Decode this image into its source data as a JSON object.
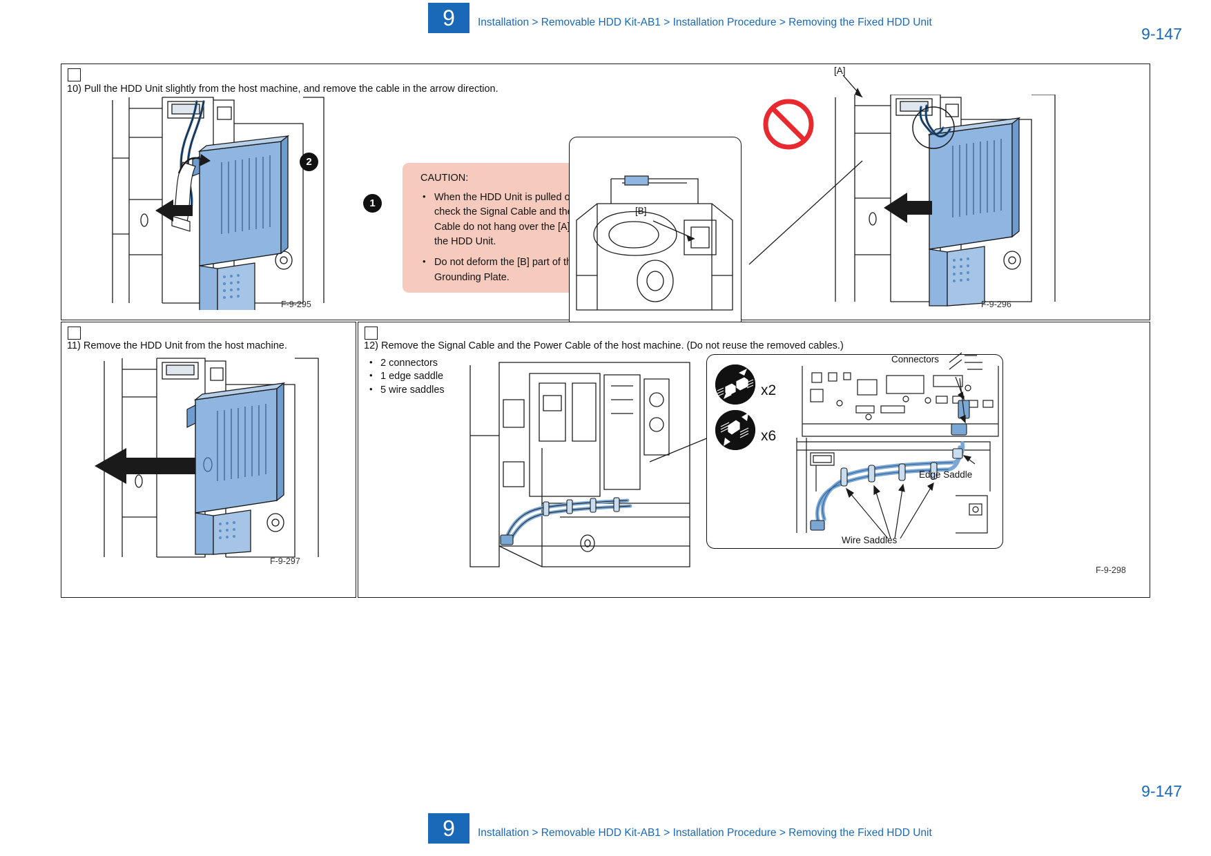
{
  "header": {
    "chapter": "9",
    "breadcrumb": "Installation > Removable HDD Kit-AB1 > Installation Procedure > Removing the Fixed HDD Unit",
    "page_number": "9-147",
    "accent_color": "#1a69b8"
  },
  "footer": {
    "chapter": "9",
    "breadcrumb": "Installation > Removable HDD Kit-AB1 > Installation Procedure > Removing the Fixed HDD Unit",
    "page_number": "9-147"
  },
  "panels": [
    {
      "id": "step-10",
      "step_text": "10) Pull the HDD Unit slightly from the host machine, and remove the cable in the arrow direction.",
      "figure_labels": [
        "F-9-295",
        "F-9-296"
      ],
      "callouts": [
        "1",
        "2"
      ],
      "part_labels": [
        "[A]",
        "[B]"
      ]
    },
    {
      "id": "step-11",
      "step_text": "11) Remove the HDD Unit from the host machine.",
      "figure_labels": [
        "F-9-297"
      ]
    },
    {
      "id": "step-12",
      "step_text": "12) Remove the Signal Cable and the Power Cable of the host machine. (Do not reuse the removed cables.)",
      "figure_labels": [
        "F-9-298"
      ],
      "parts": [
        "2 connectors",
        "1 edge saddle",
        "5 wire saddles"
      ],
      "icon_counts": [
        "x2",
        "x6"
      ],
      "detail_labels": [
        "Connectors",
        "Edge Saddle",
        "Wire Saddles"
      ]
    }
  ],
  "caution": {
    "title": "CAUTION:",
    "items": [
      "When the HDD Unit is pulled out, check the Signal Cable and the Power Cable do not hang over the [A] part of the HDD Unit.",
      "Do not deform the [B] part of the Grounding Plate."
    ],
    "background_color": "#f6cbbd"
  },
  "colors": {
    "hdd_unit_blue": "#8fb6e0",
    "hdd_unit_blue_dark": "#5b8fc9",
    "cable_blue": "#7ba7d4",
    "prohibit_red": "#e8292f",
    "line_black": "#1a1a1a"
  }
}
